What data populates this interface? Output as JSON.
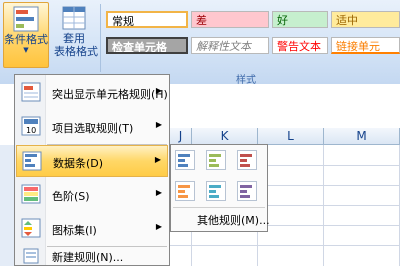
{
  "ribbon": {
    "conditional_format_label": "条件格式",
    "table_format_label_1": "套用",
    "table_format_label_2": "表格格式",
    "styles_group_label": "样式",
    "styles": {
      "normal": "常规",
      "bad": "差",
      "good": "好",
      "neutral": "适中",
      "check_cell": "检查单元格",
      "explanatory": "解释性文本",
      "warning": "警告文本",
      "linked_cell": "链接单元"
    }
  },
  "sheet": {
    "columns": [
      "J",
      "K",
      "L",
      "M"
    ]
  },
  "menu": {
    "items": [
      {
        "label": "突出显示单元格规则(H)",
        "icon": "highlight-cells-icon"
      },
      {
        "label": "项目选取规则(T)",
        "icon": "top-bottom-icon"
      },
      {
        "label": "数据条(D)",
        "icon": "data-bars-icon",
        "active": true
      },
      {
        "label": "色阶(S)",
        "icon": "color-scales-icon"
      },
      {
        "label": "图标集(I)",
        "icon": "icon-sets-icon"
      },
      {
        "label": "新建规则(N)...",
        "icon": "new-rule-icon"
      }
    ]
  },
  "submenu": {
    "more_rules": "其他规则(M)...",
    "bar_colors": [
      "#4f81bd",
      "#9bbb59",
      "#c0504d",
      "#f79646",
      "#4bacc6",
      "#8064a2"
    ]
  },
  "colors": {
    "active_menu": "#ffd766",
    "ribbon_bg": "#d3e3f6"
  }
}
